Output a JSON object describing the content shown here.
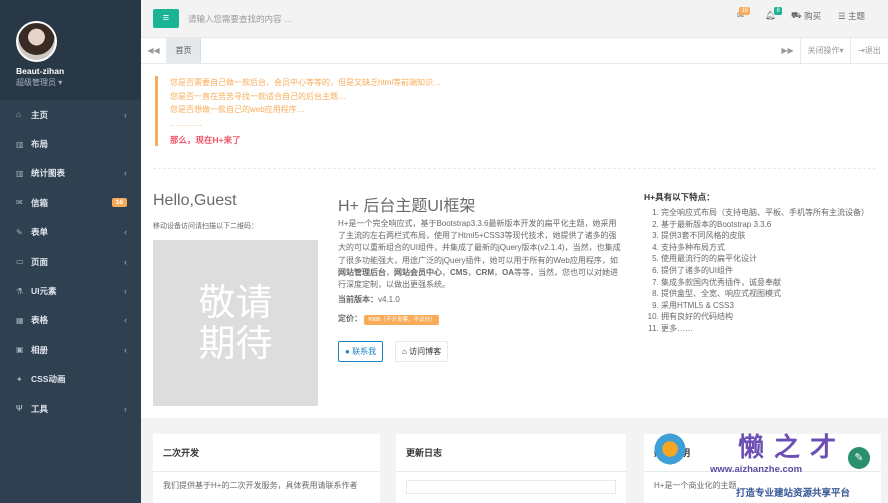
{
  "sidebar": {
    "user_name": "Beaut-zihan",
    "user_role": "超级管理员",
    "items": [
      {
        "icon": "home-icon",
        "glyph": "⌂",
        "label": "主页",
        "arrow": "‹"
      },
      {
        "icon": "columns-icon",
        "glyph": "▥",
        "label": "布局",
        "arrow": ""
      },
      {
        "icon": "bar-chart-icon",
        "glyph": "▥",
        "label": "统计图表",
        "arrow": "‹"
      },
      {
        "icon": "envelope-icon",
        "glyph": "✉",
        "label": "信箱",
        "badge": "16"
      },
      {
        "icon": "edit-icon",
        "glyph": "✎",
        "label": "表单",
        "arrow": "‹"
      },
      {
        "icon": "desktop-icon",
        "glyph": "▭",
        "label": "页面",
        "arrow": "‹"
      },
      {
        "icon": "flask-icon",
        "glyph": "⚗",
        "label": "UI元素",
        "arrow": "‹"
      },
      {
        "icon": "table-icon",
        "glyph": "▦",
        "label": "表格",
        "arrow": "‹"
      },
      {
        "icon": "picture-icon",
        "glyph": "▣",
        "label": "相册",
        "arrow": "‹"
      },
      {
        "icon": "magic-icon",
        "glyph": "✦",
        "label": "CSS动画",
        "arrow": ""
      },
      {
        "icon": "cutlery-icon",
        "glyph": "Ψ",
        "label": "工具",
        "arrow": "‹"
      }
    ]
  },
  "topbar": {
    "search_placeholder": "请输入您需要查找的内容 …",
    "mail_count": "16",
    "bell_count": "8",
    "buy": "购买",
    "theme": "主题"
  },
  "tabs": {
    "home": "首页",
    "close_ops": "关闭操作",
    "logout": "退出"
  },
  "intro": {
    "lines": [
      "您是否需要自己做一款后台、会员中心等等的，但是又缺乏html等前端知识…",
      "您是否一直在苦苦寻找一款适合自己的后台主题…",
      "您是否想做一款自己的web应用程序…",
      "…………"
    ],
    "punch": "那么，现在H+来了"
  },
  "guest": {
    "title": "Hello,Guest",
    "scan": "移动设备访问请扫描以下二维码：",
    "placeholder": "敬请\n期待"
  },
  "about": {
    "title": "H+ 后台主题UI框架",
    "desc_a": "H+是一个完全响应式，基于Bootstrap3.3.6最新版本开发的扁平化主题，她采用了主流的左右两栏式布局，使用了Html5+CSS3等现代技术，她提供了诸多的强大的可以重新组合的UI组件，并集成了最新的jQuery版本(v2.1.4)，当然，也集成了很多功能强大，用途广泛的jQuery插件，她可以用于所有的Web应用程序，如",
    "b1": "网站管理后台",
    "sep": "，",
    "b2": "网站会员中心",
    "b3": "CMS",
    "b4": "CRM",
    "b5": "OA",
    "desc_b": "等等，当然，您也可以对她进行深度定制，以做出更强系统。",
    "version_label": "当前版本：",
    "version": "v4.1.0",
    "price_label": "定价：",
    "price": "¥988（不开发票，不议价）",
    "contact_btn": "联系我",
    "visit_btn": "访问博客"
  },
  "features": {
    "title": "H+具有以下特点：",
    "items": [
      "完全响应式布局（支持电脑、平板、手机等所有主流设备）",
      "基于最新版本的Bootstrap 3.3.6",
      "提供3套不同风格的皮肤",
      "支持多种布局方式",
      "使用最流行的的扁平化设计",
      "提供了诸多的UI组件",
      "集成多款国内优秀插件，诚意奉献",
      "提供盒型、全宽、响应式视图模式",
      "采用HTML5 & CSS3",
      "拥有良好的代码结构",
      "更多……"
    ]
  },
  "bottom": {
    "dev_title": "二次开发",
    "dev_text": "我们提供基于H+的二次开发服务，具体费用请联系作者",
    "log_title": "更新日志",
    "buy_title": "购买说明",
    "buy_text": "H+是一个商业化的主题"
  },
  "watermark": {
    "brand": "懒之才",
    "url": "www.aizhanzhe.com",
    "slogan": "打造专业建站资源共享平台"
  }
}
